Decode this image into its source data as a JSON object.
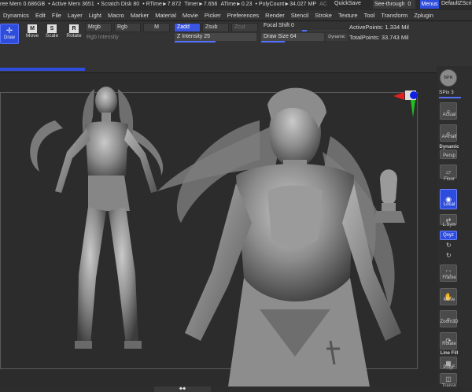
{
  "status": {
    "free_mem": "ree Mem 0.686GB",
    "active_mem": "Active Mem 3651",
    "scratch": "Scratch Disk 80",
    "rtime": "RTime►7.872",
    "timer": "Timer►7.656",
    "atime": "ATime►0.23",
    "polycount": "PolyCount►34.027 MP",
    "ac": "AC",
    "quicksave": "QuickSave",
    "seethrough": "See-through",
    "seethrough_val": "0",
    "menus": "Menus",
    "defaultscript": "DefaultZScri"
  },
  "menu": [
    "Dynamics",
    "Edit",
    "File",
    "Layer",
    "Light",
    "Macro",
    "Marker",
    "Material",
    "Movie",
    "Picker",
    "Preferences",
    "Render",
    "Stencil",
    "Stroke",
    "Texture",
    "Tool",
    "Transform",
    "Zplugin"
  ],
  "toolbar": {
    "draw": "Draw",
    "move": "Move",
    "scale": "Scale",
    "rotate": "Rotate",
    "mrgb": "Mrgb",
    "rgb": "Rgb",
    "m": "M",
    "rgb_intensity": "Rgb Intensity",
    "zadd": "Zadd",
    "zsub": "Zsub",
    "zcut": "Zcut",
    "z_intensity": "Z Intensity 25",
    "focal_shift": "Focal Shift 0",
    "draw_size": "Draw Size 64",
    "dynamic": "Dynamic",
    "active_points": "ActivePoints: 1.334 Mil",
    "total_points": "TotalPoints: 33.743 Mil"
  },
  "right": {
    "bpr": "BPR",
    "spix": "SPix 3",
    "actual": "Actual",
    "aahalf": "AAHalf",
    "dynamic": "Dynamic",
    "persp": "Persp",
    "floor": "Floor",
    "local": "Local",
    "lsym": "L.Sym",
    "xyz": "Qxyz",
    "frame": "Frame",
    "move": "Move",
    "zoom3d": "Zoom3D",
    "rotate": "Rotate",
    "linefill": "Line Fill",
    "polyf": "PolyF",
    "transp": "Transp"
  }
}
